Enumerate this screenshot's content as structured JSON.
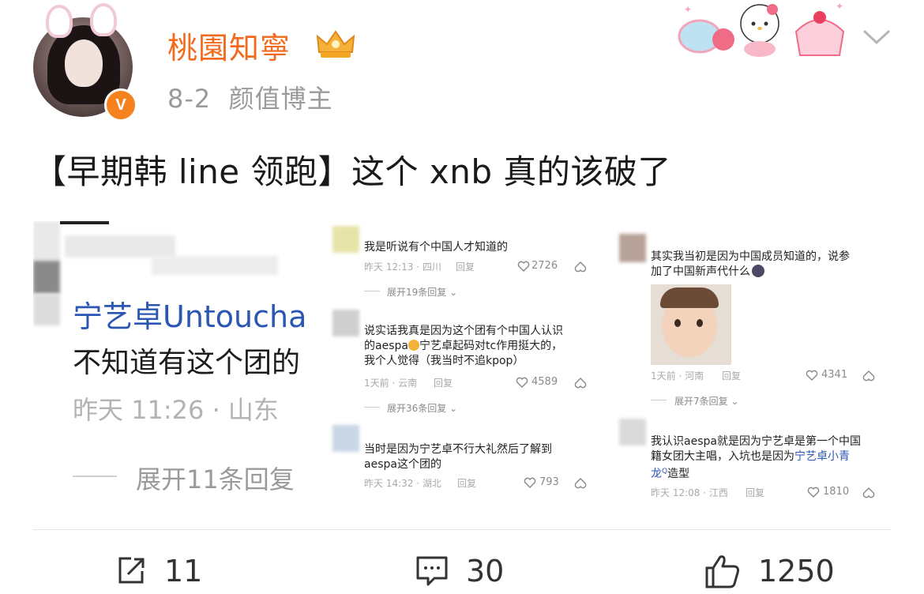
{
  "post": {
    "username": "桃園知寧",
    "date": "8-2",
    "tag": "颜值博主",
    "verified_mark": "V",
    "text": "【早期韩 line 领跑】这个 xnb 真的该破了"
  },
  "image1": {
    "title": "宁艺卓Untoucha",
    "text": "不知道有这个团的",
    "time": "昨天 11:26 · 山东",
    "expand": "展开11条回复"
  },
  "image2": {
    "comments": [
      {
        "text": "我是听说有个中国人才知道的",
        "meta": "昨天 12:13 · 四川",
        "reply": "回复",
        "likes": "2726",
        "expand": "展开19条回复"
      },
      {
        "text1": "说实话我真是因为这个团有个中国人认识",
        "text2": "的aespa",
        "text2b": "宁艺卓起码对tc作用挺大的，",
        "text3": "我个人觉得（我当时不追kpop）",
        "meta": "1天前 · 云南",
        "reply": "回复",
        "likes": "4589",
        "expand": "展开36条回复"
      },
      {
        "text1": "当时是因为宁艺卓不行大礼然后了解到",
        "text2": "aespa这个团的",
        "meta": "昨天 14:32 · 湖北",
        "reply": "回复",
        "likes": "793"
      }
    ]
  },
  "image3": {
    "comments": [
      {
        "text1": "其实我当初是因为中国成员知道的，说参",
        "text2": "加了中国新声代什么",
        "meta": "1天前 · 河南",
        "reply": "回复",
        "likes": "4341",
        "expand": "展开7条回复"
      },
      {
        "text1": "我认识aespa就是因为宁艺卓是第一个中国",
        "text2": "籍女团大主唱，入坑也是因为",
        "text2_link": "宁艺卓小青",
        "text3_link": "龙",
        "text3": "造型",
        "meta": "昨天 12:08 · 江西",
        "reply": "回复",
        "likes": "1810"
      }
    ]
  },
  "actions": {
    "reposts": "11",
    "comments": "30",
    "likes": "1250"
  },
  "colors": {
    "username": "#f26b1d",
    "verified": "#f5821f",
    "link": "#2b57b3"
  }
}
